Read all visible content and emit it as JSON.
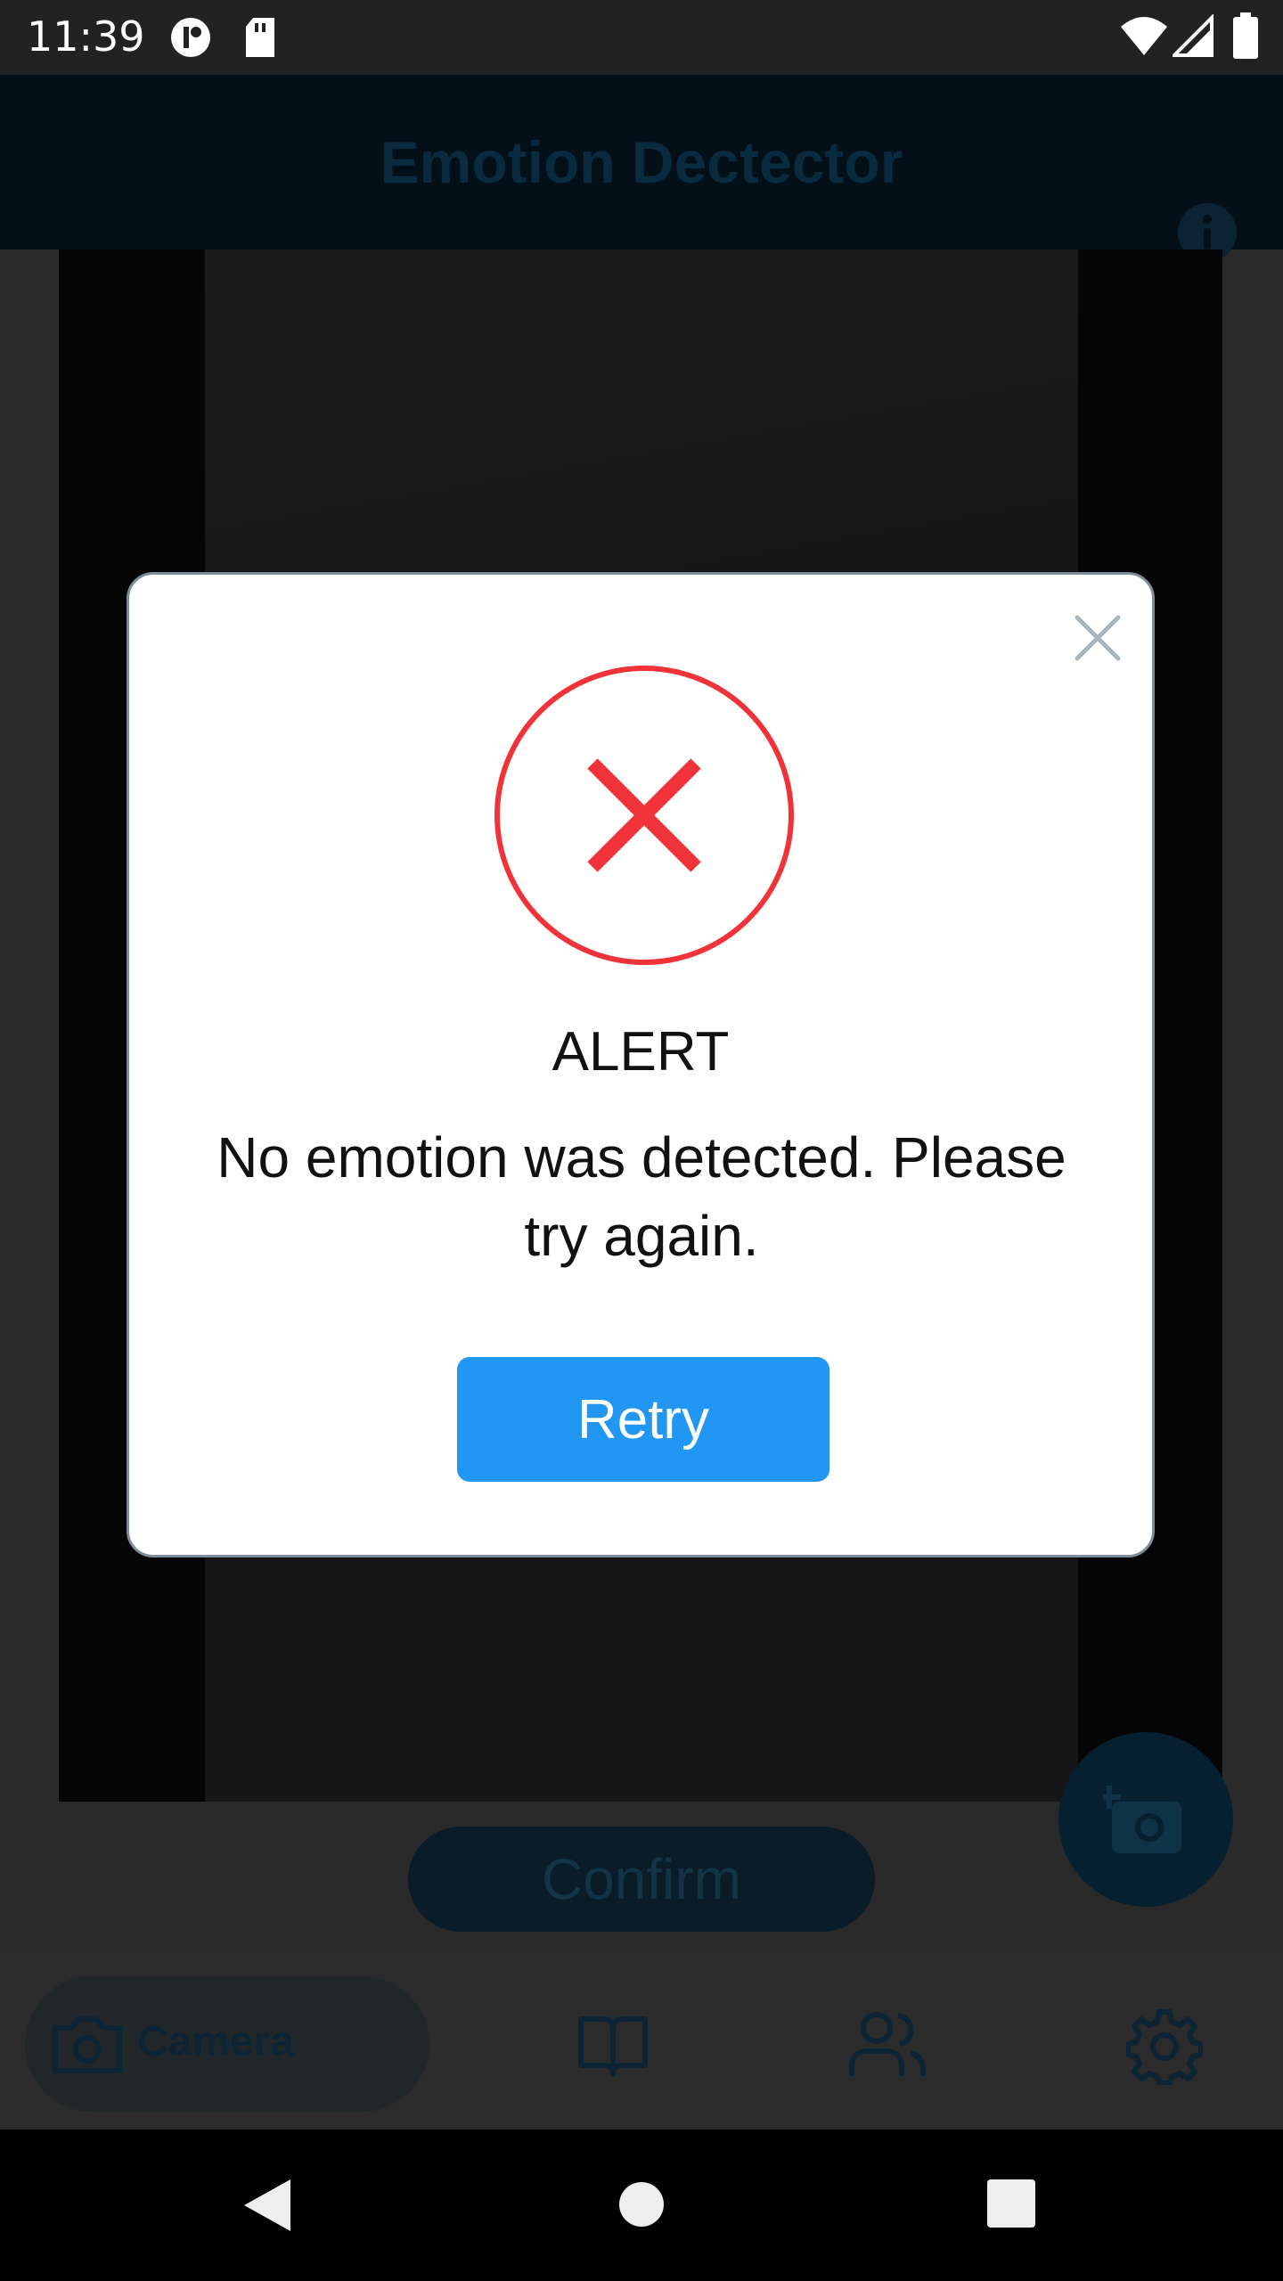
{
  "statusbar": {
    "time": "11:39"
  },
  "appbar": {
    "title": "Emotion Dectector",
    "info_icon": "info-icon"
  },
  "camera": {
    "confirm_label": "Confirm",
    "fab_icon": "add-photo-icon"
  },
  "bottom_nav": {
    "items": [
      {
        "label": "Camera",
        "icon": "camera-icon"
      },
      {
        "icon": "book-icon"
      },
      {
        "icon": "users-icon"
      },
      {
        "icon": "gear-icon"
      }
    ]
  },
  "dialog": {
    "title": "ALERT",
    "message": "No emotion was detected. Please try again.",
    "button": "Retry",
    "status_icon": "error-x-icon",
    "close_icon": "close-icon"
  },
  "colors": {
    "error": "#f03339",
    "primary": "#2196f3",
    "appbar": "#031018"
  }
}
